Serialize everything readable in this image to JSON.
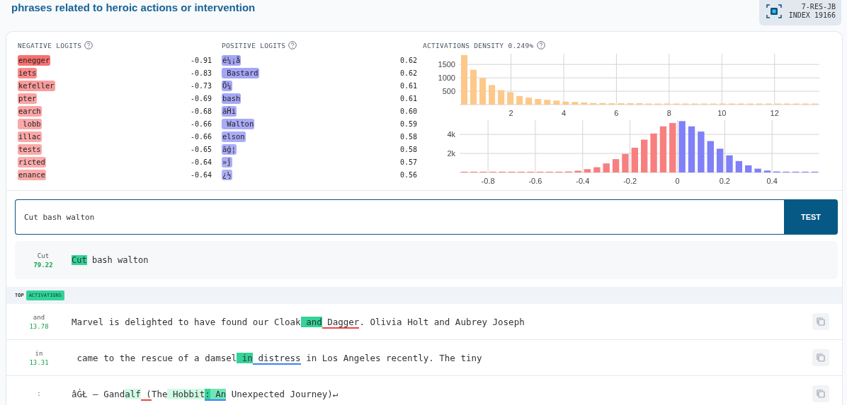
{
  "header": {
    "title": "phrases related to heroic actions or intervention",
    "badge_lines": [
      "7-RES-JB",
      "INDEX 19166"
    ]
  },
  "negative_logits": {
    "title": "NEGATIVE LOGITS",
    "items": [
      {
        "token": "enegger",
        "value": "-0.91",
        "color": "#f87171"
      },
      {
        "token": "iets",
        "value": "-0.83",
        "color": "#f98a8a"
      },
      {
        "token": "kefeller",
        "value": "-0.73",
        "color": "#fa9c9c"
      },
      {
        "token": "pter",
        "value": "-0.69",
        "color": "#fba3a3"
      },
      {
        "token": "earch",
        "value": "-0.68",
        "color": "#fba4a4"
      },
      {
        "token": " lobb",
        "value": "-0.66",
        "color": "#fba8a8"
      },
      {
        "token": "illac",
        "value": "-0.66",
        "color": "#fba8a8"
      },
      {
        "token": "tests",
        "value": "-0.65",
        "color": "#fba9a9"
      },
      {
        "token": "ricted",
        "value": "-0.64",
        "color": "#fbabab"
      },
      {
        "token": "enance",
        "value": "-0.64",
        "color": "#fbabab"
      }
    ]
  },
  "positive_logits": {
    "title": "POSITIVE LOGITS",
    "items": [
      {
        "token": "é¼¡å",
        "value": "0.62",
        "color": "#a5a5f7"
      },
      {
        "token": " Bastard",
        "value": "0.62",
        "color": "#a5a5f7"
      },
      {
        "token": "Ö¼",
        "value": "0.61",
        "color": "#a7a7f7"
      },
      {
        "token": "bash",
        "value": "0.61",
        "color": "#a7a7f7"
      },
      {
        "token": "ãĤi",
        "value": "0.60",
        "color": "#a9a9f7"
      },
      {
        "token": " Walton",
        "value": "0.59",
        "color": "#aaaaf7"
      },
      {
        "token": "elson",
        "value": "0.58",
        "color": "#acacf7"
      },
      {
        "token": "ãģ¦",
        "value": "0.58",
        "color": "#acacf7"
      },
      {
        "token": "»ĵ",
        "value": "0.57",
        "color": "#aeaef7"
      },
      {
        "token": "¿½",
        "value": "0.56",
        "color": "#b0b0f7"
      }
    ]
  },
  "density": {
    "title": "ACTIVATIONS DENSITY 0.249%",
    "chart_data": {
      "type": "bar",
      "x": [
        0.225,
        0.575,
        0.925,
        1.275,
        1.625,
        1.975,
        2.325,
        2.675,
        3.025,
        3.375,
        3.725,
        4.075,
        4.425,
        4.775,
        5.125,
        5.475,
        5.825,
        6.175,
        6.525,
        6.875,
        7.225,
        7.575,
        7.925,
        8.275,
        8.625,
        8.975,
        9.325,
        9.675,
        10.025,
        10.375,
        10.725,
        11.075,
        11.425,
        11.775,
        12.125,
        12.475,
        12.825,
        13.175,
        13.525
      ],
      "series": [
        {
          "color": "#fdc88a",
          "values": [
            1850,
            1300,
            990,
            730,
            540,
            460,
            320,
            260,
            210,
            180,
            150,
            110,
            100,
            80,
            60,
            60,
            50,
            50,
            50,
            50,
            40,
            40,
            40,
            40,
            40,
            40,
            40,
            40,
            40,
            40,
            40,
            40,
            40,
            40,
            40,
            40,
            40,
            40,
            40
          ]
        }
      ],
      "grid": true,
      "xlim": [
        0.05,
        13.7
      ],
      "ylim": [
        0,
        1900
      ],
      "xticks": [
        2,
        4,
        6,
        8,
        10,
        12
      ],
      "yticks": [
        500,
        1000,
        1500
      ]
    }
  },
  "logit_histogram": {
    "chart_data": {
      "type": "bar",
      "x": [
        -0.9,
        -0.86,
        -0.82,
        -0.78,
        -0.74,
        -0.7,
        -0.66,
        -0.62,
        -0.58,
        -0.54,
        -0.5,
        -0.46,
        -0.42,
        -0.38,
        -0.34,
        -0.3,
        -0.26,
        -0.22,
        -0.18,
        -0.14,
        -0.1,
        -0.06,
        -0.02,
        0.02,
        0.06,
        0.1,
        0.14,
        0.18,
        0.22,
        0.26,
        0.3,
        0.34,
        0.38,
        0.42,
        0.46,
        0.5,
        0.54,
        0.58
      ],
      "series": [
        {
          "color": "#f87f7f",
          "values": [
            80,
            80,
            80,
            80,
            80,
            80,
            80,
            80,
            80,
            80,
            80,
            100,
            180,
            350,
            550,
            950,
            1400,
            1950,
            2600,
            3450,
            4100,
            4850,
            5200,
            null,
            null,
            null,
            null,
            null,
            null,
            null,
            null,
            null,
            null,
            null,
            null,
            null,
            null,
            null
          ]
        },
        {
          "color": "#8080f8",
          "values": [
            null,
            null,
            null,
            null,
            null,
            null,
            null,
            null,
            null,
            null,
            null,
            null,
            null,
            null,
            null,
            null,
            null,
            null,
            null,
            null,
            null,
            null,
            null,
            5400,
            4850,
            4300,
            3300,
            2500,
            1800,
            1200,
            750,
            400,
            200,
            100,
            80,
            80,
            80,
            80
          ]
        }
      ],
      "grid": true,
      "xlim": [
        -0.92,
        0.6
      ],
      "ylim": [
        0,
        5500
      ],
      "xticks": [
        -0.8,
        -0.6,
        -0.4,
        -0.2,
        0,
        0.2,
        0.4
      ],
      "yticks": [
        {
          "value": 2000,
          "label": "2k"
        },
        {
          "value": 4000,
          "label": "4k"
        }
      ]
    }
  },
  "test": {
    "value": "Cut bash walton",
    "button": "TEST",
    "result": {
      "token": "Cut",
      "score": "79.22",
      "segments": [
        {
          "text": "Cut",
          "kind": "max"
        },
        {
          "text": " bash walton",
          "kind": "plain"
        }
      ]
    }
  },
  "top_activations": {
    "label": "TOP",
    "badge": "ACTIVATIONS"
  },
  "rows": [
    {
      "token": "and",
      "score": "13.78",
      "segments": [
        {
          "text": "Marvel is delighted to have found our Cloak",
          "kind": "plain"
        },
        {
          "text": " and",
          "kind": "max"
        },
        {
          "text": " Dagger",
          "kind": "plain",
          "color": "#ef4444"
        },
        {
          "text": ". Olivia Holt and Aubrey Joseph",
          "kind": "plain"
        }
      ]
    },
    {
      "token": "in",
      "score": "13.31",
      "segments": [
        {
          "text": " came to the rescue of a damsel",
          "kind": "plain"
        },
        {
          "text": " in",
          "kind": "max"
        },
        {
          "text": " distress",
          "kind": "plain",
          "color": "#3b82f6"
        },
        {
          "text": " in Los Angeles recently. The tiny",
          "kind": "plain"
        }
      ]
    },
    {
      "token": ":",
      "segments": [
        {
          "text": "âĠŁ – Gand",
          "kind": "plain"
        },
        {
          "text": "alf",
          "kind": "faint"
        },
        {
          "text": " (",
          "kind": "plain",
          "color": "#ef4444"
        },
        {
          "text": "The",
          "kind": "plain"
        },
        {
          "text": " Hobbit",
          "kind": "faint"
        },
        {
          "text": ":",
          "kind": "max",
          "color": "#3b82f6"
        },
        {
          "text": " An",
          "kind": "medium",
          "color": "#3b82f6"
        },
        {
          "text": " Unexpected Journey)↵",
          "kind": "plain"
        }
      ]
    }
  ]
}
